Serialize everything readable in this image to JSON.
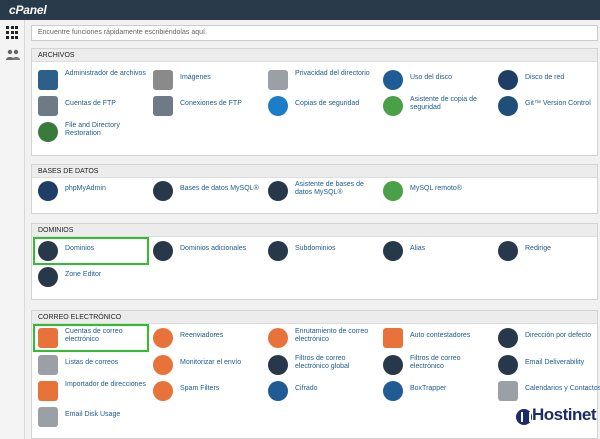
{
  "header": {
    "logo": "cPanel"
  },
  "search": {
    "placeholder": "Encuentre funciones rápidamente escribiéndolas aquí."
  },
  "sections": [
    {
      "title": "ARCHIVOS",
      "items": [
        "Administrador de archivos",
        "Imágenes",
        "Privacidad del directorio",
        "Uso del disco",
        "Disco de red",
        "Cuentas de FTP",
        "Conexiones de FTP",
        "Copias de seguridad",
        "Asistente de copia de seguridad",
        "Git™ Version Control",
        "File and Directory Restoration"
      ]
    },
    {
      "title": "BASES DE DATOS",
      "items": [
        "phpMyAdmin",
        "Bases de datos MySQL®",
        "Asistente de bases de datos MySQL®",
        "MySQL remoto®"
      ]
    },
    {
      "title": "DOMINIOS",
      "items": [
        "Dominios",
        "Dominios adicionales",
        "Subdominios",
        "Alias",
        "Redirige",
        "Zone Editor"
      ]
    },
    {
      "title": "CORREO ELECTRÓNICO",
      "items": [
        "Cuentas de correo electrónico",
        "Reenviadores",
        "Enrutamiento de correo electrónico",
        "Auto contestadores",
        "Dirección por defecto",
        "Listas de correos",
        "Monitorizar el envío",
        "Filtros de correo electrónico global",
        "Filtros de correo electrónico",
        "Email Deliverability",
        "Importador de direcciones",
        "Spam Filters",
        "Cifrado",
        "BoxTrapper",
        "Calendarios y Contactos",
        "Email Disk Usage"
      ]
    }
  ],
  "icons": {
    "archivos": [
      "file-manager-icon",
      "images-icon",
      "directory-privacy-icon",
      "disk-usage-icon",
      "network-disk-icon",
      "ftp-accounts-icon",
      "ftp-connections-icon",
      "backup-icon",
      "backup-wizard-icon",
      "git-icon",
      "file-restore-icon"
    ],
    "bases": [
      "phpmyadmin-icon",
      "mysql-databases-icon",
      "mysql-wizard-icon",
      "remote-mysql-icon"
    ],
    "dominios": [
      "domains-icon",
      "addon-domains-icon",
      "subdomains-icon",
      "aliases-icon",
      "redirects-icon",
      "zone-editor-icon"
    ],
    "correo": [
      "email-accounts-icon",
      "forwarders-icon",
      "email-routing-icon",
      "autoresponders-icon",
      "default-address-icon",
      "mailing-lists-icon",
      "track-delivery-icon",
      "global-email-filters-icon",
      "email-filters-icon",
      "email-deliverability-icon",
      "address-importer-icon",
      "spam-filters-icon",
      "encryption-icon",
      "boxtrapper-icon",
      "calendars-contacts-icon",
      "email-disk-usage-icon"
    ]
  },
  "highlighted": [
    "Dominios",
    "Cuentas de correo electrónico"
  ],
  "watermark": {
    "text": "Hostinet"
  },
  "colors": {
    "topbar": "#293a4a",
    "link": "#1d5a8f",
    "highlight": "#2ebe2e"
  }
}
